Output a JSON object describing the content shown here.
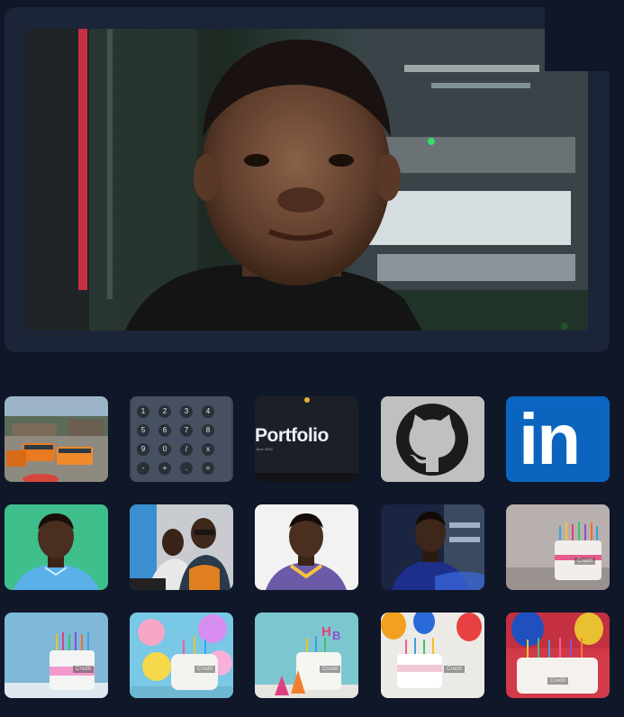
{
  "hero": {
    "alt": "Portrait of man in front of server rack"
  },
  "gallery": {
    "portfolio_title": "Portfolio",
    "portfolio_subtitle": "June 2020",
    "calc_keys": [
      "1",
      "2",
      "3",
      "4",
      "5",
      "6",
      "7",
      "8",
      "9",
      "0",
      "/",
      "x",
      "-",
      "+",
      ".",
      "="
    ],
    "card_caption": "Credit"
  },
  "icons": {
    "github": "github-icon",
    "linkedin": "linkedin-icon",
    "linkedin_text": "in"
  },
  "colors": {
    "background": "#0f1729",
    "panel": "#1b2537",
    "linkedin_blue": "#0a66c2",
    "github_gray": "#bfbfbf"
  }
}
